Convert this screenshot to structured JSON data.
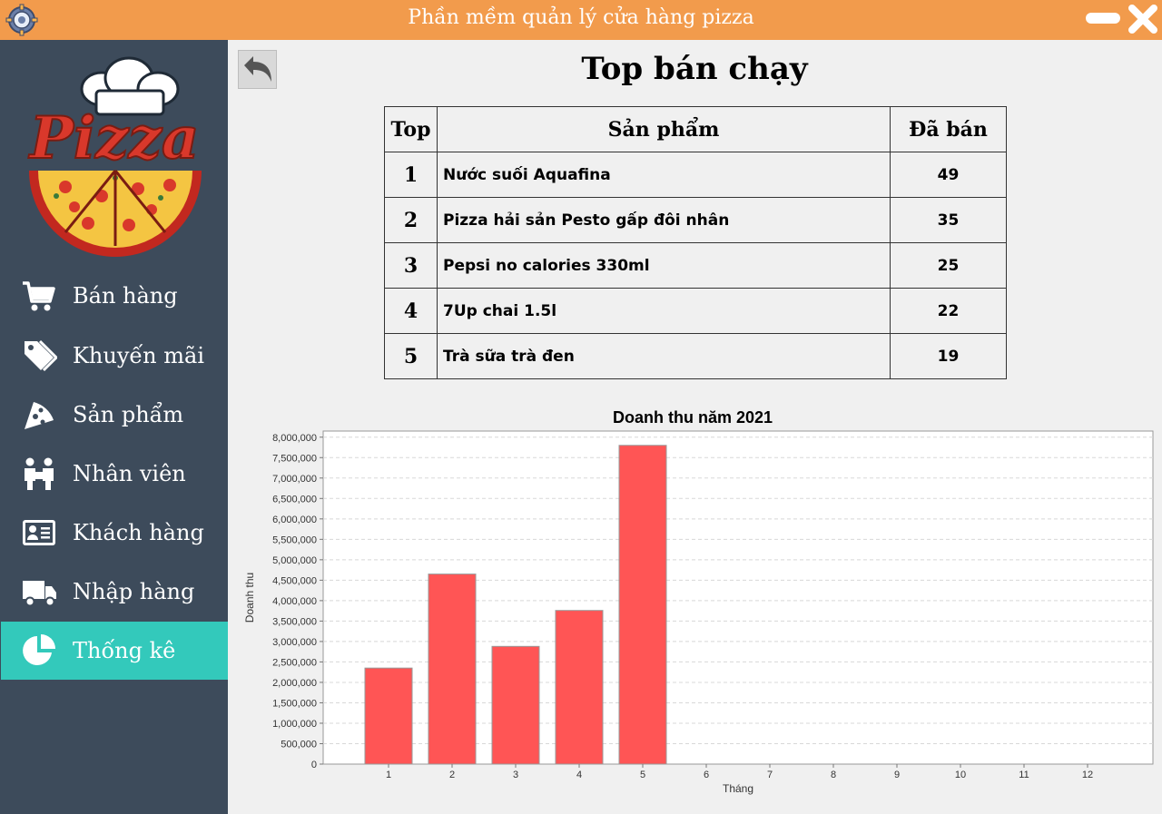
{
  "window": {
    "title": "Phần mềm quản lý cửa hàng pizza",
    "accent_color": "#f29b4c",
    "icons": {
      "app": "gear-icon",
      "minimize": "minimize-icon",
      "close": "close-icon"
    }
  },
  "sidebar": {
    "logo_text": "Pizza",
    "background_color": "#3d4b5b",
    "active_color": "#33c9bb",
    "items": [
      {
        "label": "Bán hàng",
        "icon": "cart-icon",
        "active": false
      },
      {
        "label": "Khuyến mãi",
        "icon": "tags-icon",
        "active": false
      },
      {
        "label": "Sản phẩm",
        "icon": "pizza-slice-icon",
        "active": false
      },
      {
        "label": "Nhân viên",
        "icon": "staff-icon",
        "active": false
      },
      {
        "label": "Khách hàng",
        "icon": "id-card-icon",
        "active": false
      },
      {
        "label": "Nhập hàng",
        "icon": "truck-icon",
        "active": false
      },
      {
        "label": "Thống kê",
        "icon": "pie-chart-icon",
        "active": true
      }
    ]
  },
  "main": {
    "back_icon": "back-arrow-icon",
    "title": "Top bán chạy",
    "table": {
      "headers": [
        "Top",
        "Sản phẩm",
        "Đã bán"
      ],
      "rows": [
        {
          "rank": "1",
          "product": "Nước suối Aquafina",
          "sold": "49"
        },
        {
          "rank": "2",
          "product": "Pizza hải sản Pesto gấp đôi nhân",
          "sold": "35"
        },
        {
          "rank": "3",
          "product": "Pepsi no calories 330ml",
          "sold": "25"
        },
        {
          "rank": "4",
          "product": "7Up chai 1.5l",
          "sold": "22"
        },
        {
          "rank": "5",
          "product": "Trà sữa trà đen",
          "sold": "19"
        }
      ]
    }
  },
  "chart_data": {
    "type": "bar",
    "title": "Doanh thu năm 2021",
    "xlabel": "Tháng",
    "ylabel": "Doanh thu",
    "categories": [
      "1",
      "2",
      "3",
      "4",
      "5",
      "6",
      "7",
      "8",
      "9",
      "10",
      "11",
      "12"
    ],
    "values": [
      2350000,
      4650000,
      2880000,
      3760000,
      7800000,
      0,
      0,
      0,
      0,
      0,
      0,
      0
    ],
    "ylim": [
      0,
      8150000
    ],
    "yticks": [
      0,
      500000,
      1000000,
      1500000,
      2000000,
      2500000,
      3000000,
      3500000,
      4000000,
      4500000,
      5000000,
      5500000,
      6000000,
      6500000,
      7000000,
      7500000,
      8000000
    ],
    "ytick_labels": [
      "0",
      "500,000",
      "1,000,000",
      "1,500,000",
      "2,000,000",
      "2,500,000",
      "3,000,000",
      "3,500,000",
      "4,000,000",
      "4,500,000",
      "5,000,000",
      "5,500,000",
      "6,000,000",
      "6,500,000",
      "7,000,000",
      "7,500,000",
      "8,000,000"
    ],
    "grid": true,
    "bar_color": "#ff5555"
  }
}
